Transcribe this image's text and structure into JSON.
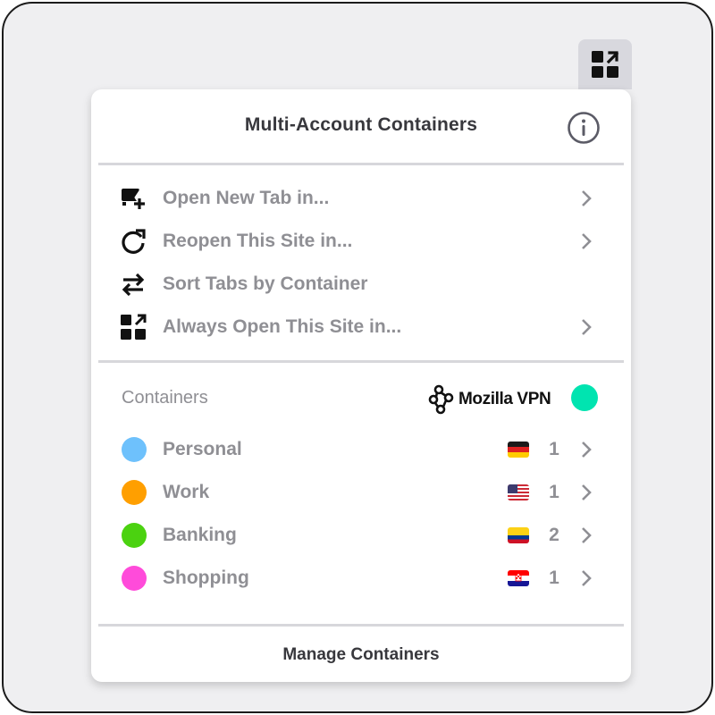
{
  "toolbar": {
    "icon": "containers-extension-icon"
  },
  "panel": {
    "title": "Multi-Account Containers",
    "info_icon": "info-icon"
  },
  "menu": [
    {
      "label": "Open New Tab in...",
      "icon": "new-tab-icon",
      "has_submenu": true
    },
    {
      "label": "Reopen This Site in...",
      "icon": "reload-icon",
      "has_submenu": true
    },
    {
      "label": "Sort Tabs by Container",
      "icon": "sort-arrows-icon",
      "has_submenu": false
    },
    {
      "label": "Always Open This Site in...",
      "icon": "always-open-icon",
      "has_submenu": true
    }
  ],
  "containers_section": {
    "label": "Containers",
    "vpn_label": "Mozilla VPN",
    "vpn_status_color": "#00e4b0"
  },
  "containers": [
    {
      "name": "Personal",
      "color": "#6ec1fc",
      "flag": "germany",
      "count": "1"
    },
    {
      "name": "Work",
      "color": "#ff9f00",
      "flag": "usa",
      "count": "1"
    },
    {
      "name": "Banking",
      "color": "#4bd210",
      "flag": "colombia",
      "count": "2"
    },
    {
      "name": "Shopping",
      "color": "#ff4bda",
      "flag": "croatia",
      "count": "1"
    }
  ],
  "footer": {
    "manage_label": "Manage Containers"
  }
}
